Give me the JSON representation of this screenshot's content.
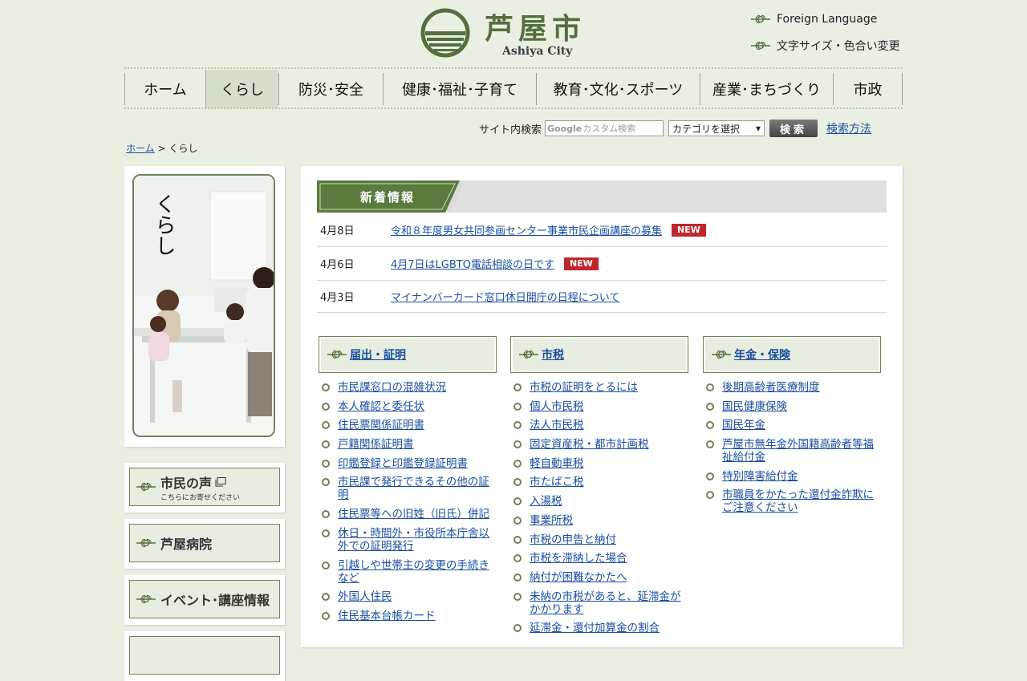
{
  "header": {
    "logo_title": "芦屋市",
    "logo_subtitle": "Ashiya City",
    "foreign_language": "Foreign Language",
    "font_size_color": "文字サイズ・色合い変更"
  },
  "nav": {
    "items": [
      {
        "label": "ホーム"
      },
      {
        "label": "くらし"
      },
      {
        "label": "防災･安全"
      },
      {
        "label": "健康･福祉･子育て"
      },
      {
        "label": "教育･文化･スポーツ"
      },
      {
        "label": "産業･まちづくり"
      },
      {
        "label": "市政"
      }
    ],
    "active_index": 1
  },
  "search": {
    "label": "サイト内検索",
    "google_mark": "Google",
    "placeholder": "カスタム検索",
    "category_selected": "カテゴリを選択",
    "button": "検索",
    "help_link": "検索方法"
  },
  "breadcrumb": {
    "home": "ホーム",
    "separator": ">",
    "current": "くらし"
  },
  "side": {
    "photo_title": "くらし",
    "voice_label": "市民の声",
    "voice_sub": "こちらにお寄せください",
    "hospital_label": "芦屋病院",
    "events_label": "イベント･講座情報"
  },
  "news": {
    "heading": "新着情報",
    "items": [
      {
        "date": "4月8日",
        "title": "令和８年度男女共同参画センター事業市民企画講座の募集",
        "badge": "NEW"
      },
      {
        "date": "4月6日",
        "title": "4月7日はLGBTQ電話相談の日です",
        "badge": "NEW"
      },
      {
        "date": "4月3日",
        "title": "マイナンバーカード窓口休日開庁の日程について"
      }
    ]
  },
  "categories": [
    {
      "title": "届出・証明",
      "links": [
        "市民課窓口の混雑状況",
        "本人確認と委任状",
        "住民票関係証明書",
        "戸籍関係証明書",
        "印鑑登録と印鑑登録証明書",
        "市民課で発行できるその他の証明",
        "住民票等への旧姓（旧氏）併記",
        "休日・時間外・市役所本庁舎以外での証明発行",
        "引越しや世帯主の変更の手続きなど",
        "外国人住民",
        "住民基本台帳カード"
      ]
    },
    {
      "title": "市税",
      "links": [
        "市税の証明をとるには",
        "個人市民税",
        "法人市民税",
        "固定資産税・都市計画税",
        "軽自動車税",
        "市たばこ税",
        "入湯税",
        "事業所税",
        "市税の申告と納付",
        "市税を滞納した場合",
        "納付が困難なかたへ",
        "未納の市税があると、延滞金がかかります",
        "延滞金・還付加算金の割合"
      ]
    },
    {
      "title": "年金・保険",
      "links": [
        "後期高齢者医療制度",
        "国民健康保険",
        "国民年金",
        "芦屋市無年金外国籍高齢者等福祉給付金",
        "特別障害給付金",
        "市職員をかたった還付金詐欺にご注意ください"
      ]
    }
  ]
}
